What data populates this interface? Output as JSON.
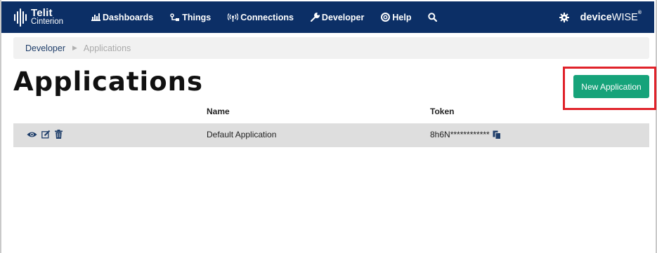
{
  "logo": {
    "line1": "Telit",
    "line2": "Cinterion"
  },
  "nav": {
    "items": [
      {
        "label": "Dashboards",
        "icon": "bar-chart-icon"
      },
      {
        "label": "Things",
        "icon": "things-icon"
      },
      {
        "label": "Connections",
        "icon": "signal-icon"
      },
      {
        "label": "Developer",
        "icon": "wrench-icon"
      },
      {
        "label": "Help",
        "icon": "lifebuoy-icon"
      }
    ],
    "search_icon": "search-icon",
    "settings_icon": "gear-icon",
    "brand_bold": "device",
    "brand_light": "WISE",
    "brand_mark": "®"
  },
  "breadcrumb": {
    "parent": "Developer",
    "current": "Applications"
  },
  "page": {
    "title": "Applications",
    "new_button": "New Application"
  },
  "table": {
    "headers": {
      "actions": "",
      "name": "Name",
      "token": "Token"
    },
    "rows": [
      {
        "name": "Default Application",
        "token": "8h6N************"
      }
    ]
  },
  "colors": {
    "navbar": "#0c2f66",
    "button": "#16a37a",
    "highlight": "#e0222a",
    "row": "#dedede",
    "breadcrumb_bg": "#f1f1f1"
  }
}
